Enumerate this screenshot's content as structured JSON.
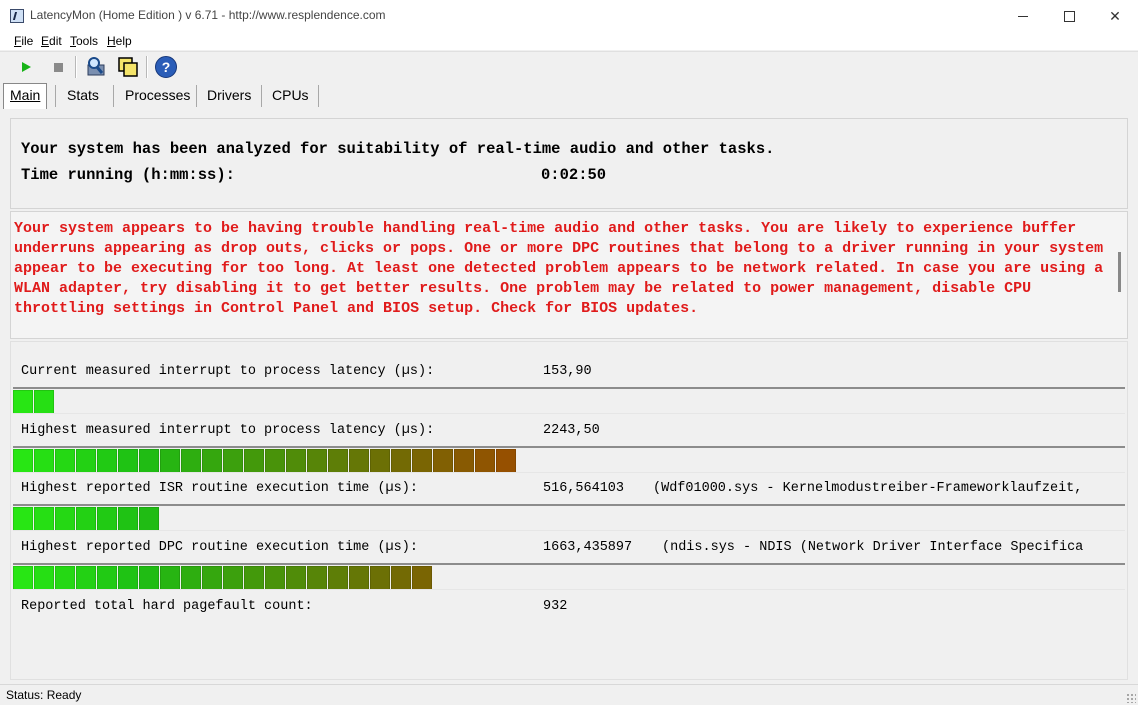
{
  "window": {
    "title": "LatencyMon  (Home Edition )  v 6.71 - http://www.resplendence.com",
    "minimize_label": "minimize",
    "maximize_label": "maximize",
    "close_glyph": "✕"
  },
  "menu": {
    "items": [
      {
        "key": "F",
        "rest": "ile"
      },
      {
        "key": "E",
        "rest": "dit"
      },
      {
        "key": "T",
        "rest": "ools"
      },
      {
        "key": "H",
        "rest": "elp"
      }
    ]
  },
  "toolbar": {
    "icons": [
      "start-icon",
      "stop-icon",
      "analyze-icon",
      "window-icon",
      "help-icon"
    ],
    "help_glyph": "?"
  },
  "tabs": [
    {
      "label": "Main",
      "active": true
    },
    {
      "label": "Stats",
      "active": false
    },
    {
      "label": "Processes",
      "active": false
    },
    {
      "label": "Drivers",
      "active": false
    },
    {
      "label": "CPUs",
      "active": false
    }
  ],
  "summary": {
    "analyzed_text": "Your system has been analyzed for suitability of real-time audio and other tasks.",
    "time_label": "Time running (h:mm:ss):",
    "time_value": "0:02:50"
  },
  "warning": {
    "text": "Your system appears to be having trouble handling real-time audio and other tasks. You are likely to experience buffer underruns appearing as drop outs, clicks or pops. One or more DPC routines that belong to a driver running in your system appear to be executing for too long. At least one detected problem appears to be network related. In case you are using a WLAN adapter, try disabling it to get better results. One problem may be related to power management, disable CPU throttling settings in Control Panel and BIOS setup. Check for BIOS updates.",
    "color": "#e01b1b"
  },
  "stats": [
    {
      "label": "Current measured interrupt to process latency (µs):",
      "value": "153,90",
      "extra": "",
      "bar_segments": 2
    },
    {
      "label": "Highest measured interrupt to process latency (µs):",
      "value": "2243,50",
      "extra": "",
      "bar_segments": 24
    },
    {
      "label": "Highest reported ISR routine execution time (µs):",
      "value": "516,564103",
      "extra": "(Wdf01000.sys - Kernelmodustreiber-Frameworklaufzeit,",
      "bar_segments": 7
    },
    {
      "label": "Highest reported DPC routine execution time (µs):",
      "value": "1663,435897",
      "extra": "(ndis.sys - NDIS (Network Driver Interface Specifica",
      "bar_segments": 20
    },
    {
      "label": "Reported total hard pagefault count:",
      "value": "932",
      "extra": ""
    }
  ],
  "status": {
    "text": "Status: Ready"
  }
}
